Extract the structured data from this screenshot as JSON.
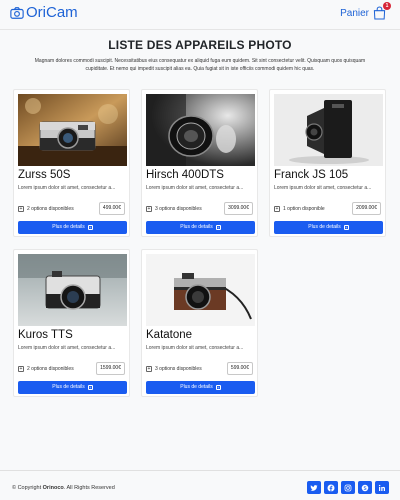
{
  "brand": {
    "name": "OriCam",
    "icon": "camera-icon"
  },
  "cart": {
    "label": "Panier",
    "count": "1",
    "icon": "shopping-bag-icon"
  },
  "page": {
    "title": "LISTE DES APPAREILS PHOTO",
    "intro": "Magnam dolores commodi suscipit. Necessitatibus eius consequatur ex aliquid fuga eum quidem. Sit sint consectetur velit. Quisquam quos quisquam cupiditate. Et nemo qui impedit suscipit alias ea. Quia fugiat sit in iste officiis commodi quidem hic quas."
  },
  "products": [
    {
      "name": "Zurss 50S",
      "desc": "Lorem ipsum dolor sit amet, consectetur a...",
      "options": "2 options disponibles",
      "price": "499.00€",
      "button": "Plus de details"
    },
    {
      "name": "Hirsch 400DTS",
      "desc": "Lorem ipsum dolor sit amet, consectetur a...",
      "options": "3 options disponibles",
      "price": "3099.00€",
      "button": "Plus de details"
    },
    {
      "name": "Franck JS 105",
      "desc": "Lorem ipsum dolor sit amet, consectetur a...",
      "options": "1 option disponible",
      "price": "2099.00€",
      "button": "Plus de details"
    },
    {
      "name": "Kuros TTS",
      "desc": "Lorem ipsum dolor sit amet, consectetur a...",
      "options": "2 options disponibles",
      "price": "1599.00€",
      "button": "Plus de details"
    },
    {
      "name": "Katatone",
      "desc": "Lorem ipsum dolor sit amet, consectetur a...",
      "options": "3 options disponibles",
      "price": "599.00€",
      "button": "Plus de details"
    }
  ],
  "footer": {
    "copyright_prefix": "© Copyright",
    "company": "Orinoco",
    "rights": ". All Rights Reserved",
    "socials": [
      "twitter-icon",
      "facebook-icon",
      "instagram-icon",
      "skype-icon",
      "linkedin-icon"
    ]
  },
  "colors": {
    "accent": "#1a5cf0",
    "brand": "#1e63d6",
    "badge": "#d72638"
  }
}
